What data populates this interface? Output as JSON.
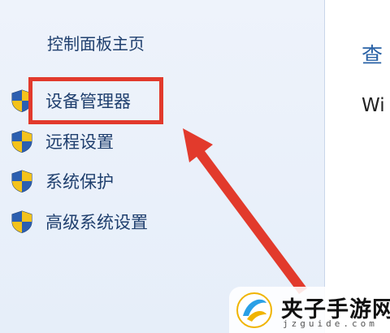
{
  "sidebar": {
    "home_link": "控制面板主页",
    "items": [
      {
        "label": "设备管理器",
        "icon": "uac-shield-icon",
        "highlighted": true
      },
      {
        "label": "远程设置",
        "icon": "uac-shield-icon"
      },
      {
        "label": "系统保护",
        "icon": "uac-shield-icon"
      },
      {
        "label": "高级系统设置",
        "icon": "uac-shield-icon"
      }
    ]
  },
  "main": {
    "heading": "查",
    "text": "Wi"
  },
  "annotation": {
    "highlight_color": "#e23a2c",
    "arrow_color": "#e23a2c"
  },
  "watermark": {
    "title": "夹子手游网",
    "subtitle": "jzguide.com"
  }
}
